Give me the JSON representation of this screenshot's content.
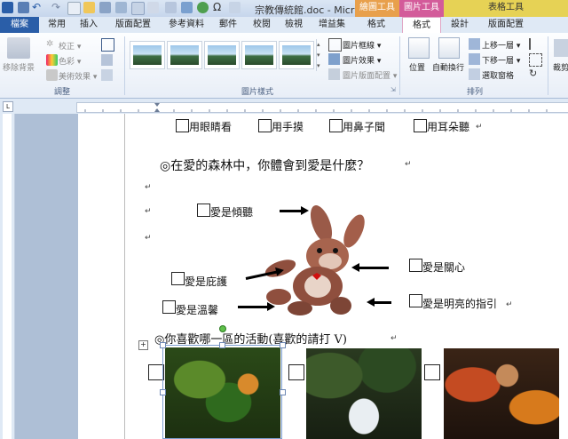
{
  "titlebar": {
    "document_title": "宗教傳統館.doc - Micr…",
    "picture_tools_label": "繪圖工具",
    "picture_tools_active_label": "圖片工具",
    "table_tools_label": "表格工具"
  },
  "tabs": [
    "檔案",
    "常用",
    "插入",
    "版面配置",
    "參考資料",
    "郵件",
    "校閱",
    "檢視",
    "增益集",
    "格式",
    "格式",
    "設計",
    "版面配置"
  ],
  "ribbon": {
    "adjust": {
      "remove_background": "移除背景",
      "corrections": "校正 ▾",
      "color": "色彩 ▾",
      "artistic_effects": "美術效果 ▾",
      "group_label": "調整"
    },
    "picture_styles": {
      "picture_border": "圖片框線 ▾",
      "picture_effects": "圖片效果 ▾",
      "picture_layout": "圖片版面配置 ▾",
      "group_label": "圖片樣式"
    },
    "arrange": {
      "position": "位置",
      "wrap_text": "自動換行",
      "bring_forward": "上移一層 ▾",
      "send_backward": "下移一層 ▾",
      "selection_pane": "選取窗格",
      "crop": "裁剪",
      "group_label": "排列"
    }
  },
  "document": {
    "senses": [
      "用眼睛看",
      "用手摸",
      "用鼻子聞",
      "用耳朵聽"
    ],
    "question1": "◎在愛的森林中，你體會到愛是什麼？",
    "love_items": {
      "listen": "愛是傾聽",
      "care": "愛是關心",
      "protect": "愛是庇護",
      "warm": "愛是溫馨",
      "guide": "愛是明亮的指引"
    },
    "question2": "◎你喜歡哪一區的活動(喜歡的請打 V)",
    "paragraph_mark": "↵"
  },
  "colors": {
    "file_tab": "#2a5ea8",
    "picture_tools": "#d35b9a",
    "drawing_tools": "#e8a04c",
    "table_tools": "#e6d255",
    "page_bg": "#aebfd6"
  }
}
